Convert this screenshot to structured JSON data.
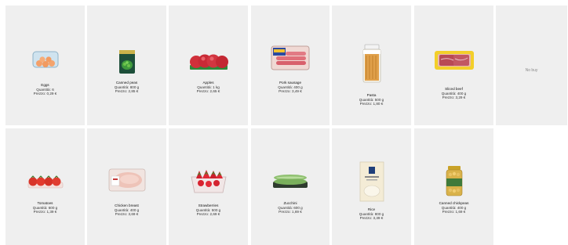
{
  "labels": {
    "quantity": "Quantità:",
    "price": "Prezzo:"
  },
  "products": [
    {
      "name": "Eggs",
      "quantity": "6",
      "price": "0,29 €",
      "icon": "eggs-carton-icon"
    },
    {
      "name": "Canned peas",
      "quantity": "800 g",
      "price": "2,85 €",
      "icon": "canned-peas-icon"
    },
    {
      "name": "Apples",
      "quantity": "1 kg",
      "price": "2,65 €",
      "icon": "apples-icon"
    },
    {
      "name": "Pork sausage",
      "quantity": "400 g",
      "price": "3,49 €",
      "icon": "pork-sausage-icon"
    },
    {
      "name": "Pasta",
      "quantity": "500 g",
      "price": "1,80 €",
      "icon": "pasta-jar-icon"
    },
    {
      "name": "Sliced beef",
      "quantity": "400 g",
      "price": "3,29 €",
      "icon": "sliced-beef-icon"
    },
    {
      "name": "Tomatoes",
      "quantity": "600 g",
      "price": "1,39 €",
      "icon": "tomatoes-icon"
    },
    {
      "name": "Chicken breast",
      "quantity": "400 g",
      "price": "3,69 €",
      "icon": "chicken-breast-icon"
    },
    {
      "name": "Strawberries",
      "quantity": "500 g",
      "price": "2,69 €",
      "icon": "strawberries-icon"
    },
    {
      "name": "Zucchini",
      "quantity": "600 g",
      "price": "1,69 €",
      "icon": "zucchini-icon"
    },
    {
      "name": "Rice",
      "quantity": "800 g",
      "price": "3,39 €",
      "icon": "rice-box-icon"
    },
    {
      "name": "Canned chickpeas",
      "quantity": "400 g",
      "price": "1,69 €",
      "icon": "canned-chickpeas-icon"
    }
  ],
  "no_buy": {
    "label": "No buy"
  }
}
